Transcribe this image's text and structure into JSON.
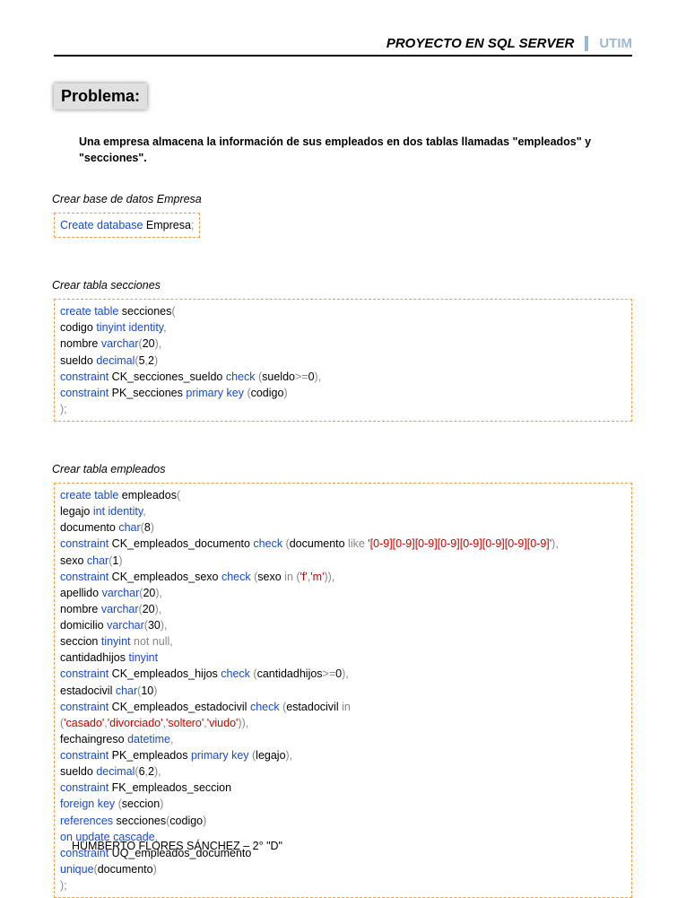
{
  "header": {
    "title": "PROYECTO EN SQL SERVER",
    "tag": "UTIM"
  },
  "heading": "Problema:",
  "problem_text": "Una empresa almacena la información de sus empleados en dos tablas llamadas \"empleados\" y \"secciones\".",
  "section1": {
    "label": "Crear base de datos Empresa"
  },
  "section2": {
    "label": "Crear tabla secciones"
  },
  "section3": {
    "label": "Crear tabla empleados"
  },
  "footer": "HUMBERTO FLORES SÁNCHEZ – 2° \"D\"",
  "code1": {
    "kw1": "Create database",
    "name": " Empresa",
    "semi": ";"
  },
  "code2": {
    "kw_ct": "create table",
    "name": " secciones",
    "open": "(",
    "l1a": "  codigo ",
    "l1b": "tinyint identity",
    "comma": ",",
    "l2a": "  nombre ",
    "l2b": "varchar",
    "l2c": "(",
    "l2d": "20",
    "l2e": "),",
    "l3a": "  sueldo ",
    "l3b": "decimal",
    "l3c": "(",
    "l3d": "5",
    "l3e": ",",
    "l3f": "2",
    "l3g": ")",
    "l4a": "   constraint",
    "l4b": " CK_secciones_sueldo ",
    "l4c": "check",
    "l4d": " (",
    "l4e": "sueldo",
    "l4f": ">=",
    "l4g": "0",
    "l4h": "),",
    "l5a": "   constraint",
    "l5b": " PK_secciones ",
    "l5c": "primary key",
    "l5d": " (",
    "l5e": "codigo",
    "l5f": ")",
    "close": " );"
  },
  "code3": {
    "kw_ct": "create table",
    "name": " empleados",
    "open": "(",
    "l1a": "  legajo ",
    "l1b": "int identity",
    "comma": ",",
    "l2a": "  documento ",
    "l2b": "char",
    "l2c": "(",
    "l2d": "8",
    "l2e": ")",
    "l3a": "   constraint",
    "l3b": " CK_empleados_documento ",
    "l3c": "check",
    "l3d": " (",
    "l3e": "documento ",
    "l3f": "like",
    "l3g": " '[0-9][0-9][0-9][0-9][0-9][0-9][0-9][0-9]'",
    "l3h": "),",
    "l4a": "  sexo ",
    "l4b": "char",
    "l4c": "(",
    "l4d": "1",
    "l4e": ")",
    "l5a": "   constraint",
    "l5b": " CK_empleados_sexo ",
    "l5c": "check",
    "l5d": " (",
    "l5e": "sexo ",
    "l5f": "in",
    "l5g": " (",
    "l5h": "'f'",
    "l5i": ",",
    "l5j": "'m'",
    "l5k": ")),",
    "l6a": "  apellido ",
    "l6b": "varchar",
    "l6c": "(",
    "l6d": "20",
    "l6e": "),",
    "l7a": "  nombre ",
    "l7b": "varchar",
    "l7c": "(",
    "l7d": "20",
    "l7e": "),",
    "l8a": "  domicilio ",
    "l8b": "varchar",
    "l8c": "(",
    "l8d": "30",
    "l8e": "),",
    "l9a": "  seccion ",
    "l9b": "tinyint",
    "l9c": " not null",
    "l10a": "  cantidadhijos ",
    "l10b": "tinyint",
    "l11a": "   constraint",
    "l11b": " CK_empleados_hijos ",
    "l11c": "check",
    "l11d": " (",
    "l11e": "cantidadhijos",
    "l11f": ">=",
    "l11g": "0",
    "l11h": "),",
    "l12a": "  estadocivil ",
    "l12b": "char",
    "l12c": "(",
    "l12d": "10",
    "l12e": ")",
    "l13a": "   constraint",
    "l13b": " CK_empleados_estadocivil ",
    "l13c": "check",
    "l13d": " (",
    "l13e": "estadocivil ",
    "l13f": "in",
    "l14a": "(",
    "l14b": "'casado'",
    "l14c": ",",
    "l14d": "'divorciado'",
    "l14e": ",",
    "l14f": "'soltero'",
    "l14g": ",",
    "l14h": "'viudo'",
    "l14i": ")),",
    "l15a": "  fechaingreso ",
    "l15b": "datetime",
    "l16a": "   constraint",
    "l16b": " PK_empleados ",
    "l16c": "primary key",
    "l16d": " (",
    "l16e": "legajo",
    "l16f": "),",
    "l17a": "  sueldo ",
    "l17b": "decimal",
    "l17c": "(",
    "l17d": "6",
    "l17e": ",",
    "l17f": "2",
    "l17g": "),",
    "l18a": "  constraint",
    "l18b": " FK_empleados_seccion",
    "l19a": "   foreign key",
    "l19b": " (",
    "l19c": "seccion",
    "l19d": ")",
    "l20a": "   references",
    "l20b": " secciones",
    "l20c": "(",
    "l20d": "codigo",
    "l20e": ")",
    "l21a": "   on update cascade",
    "l22a": "  constraint",
    "l22b": " UQ_empleados_documento",
    "l23a": "   unique",
    "l23b": "(",
    "l23c": "documento",
    "l23d": ")",
    "close": " );"
  }
}
